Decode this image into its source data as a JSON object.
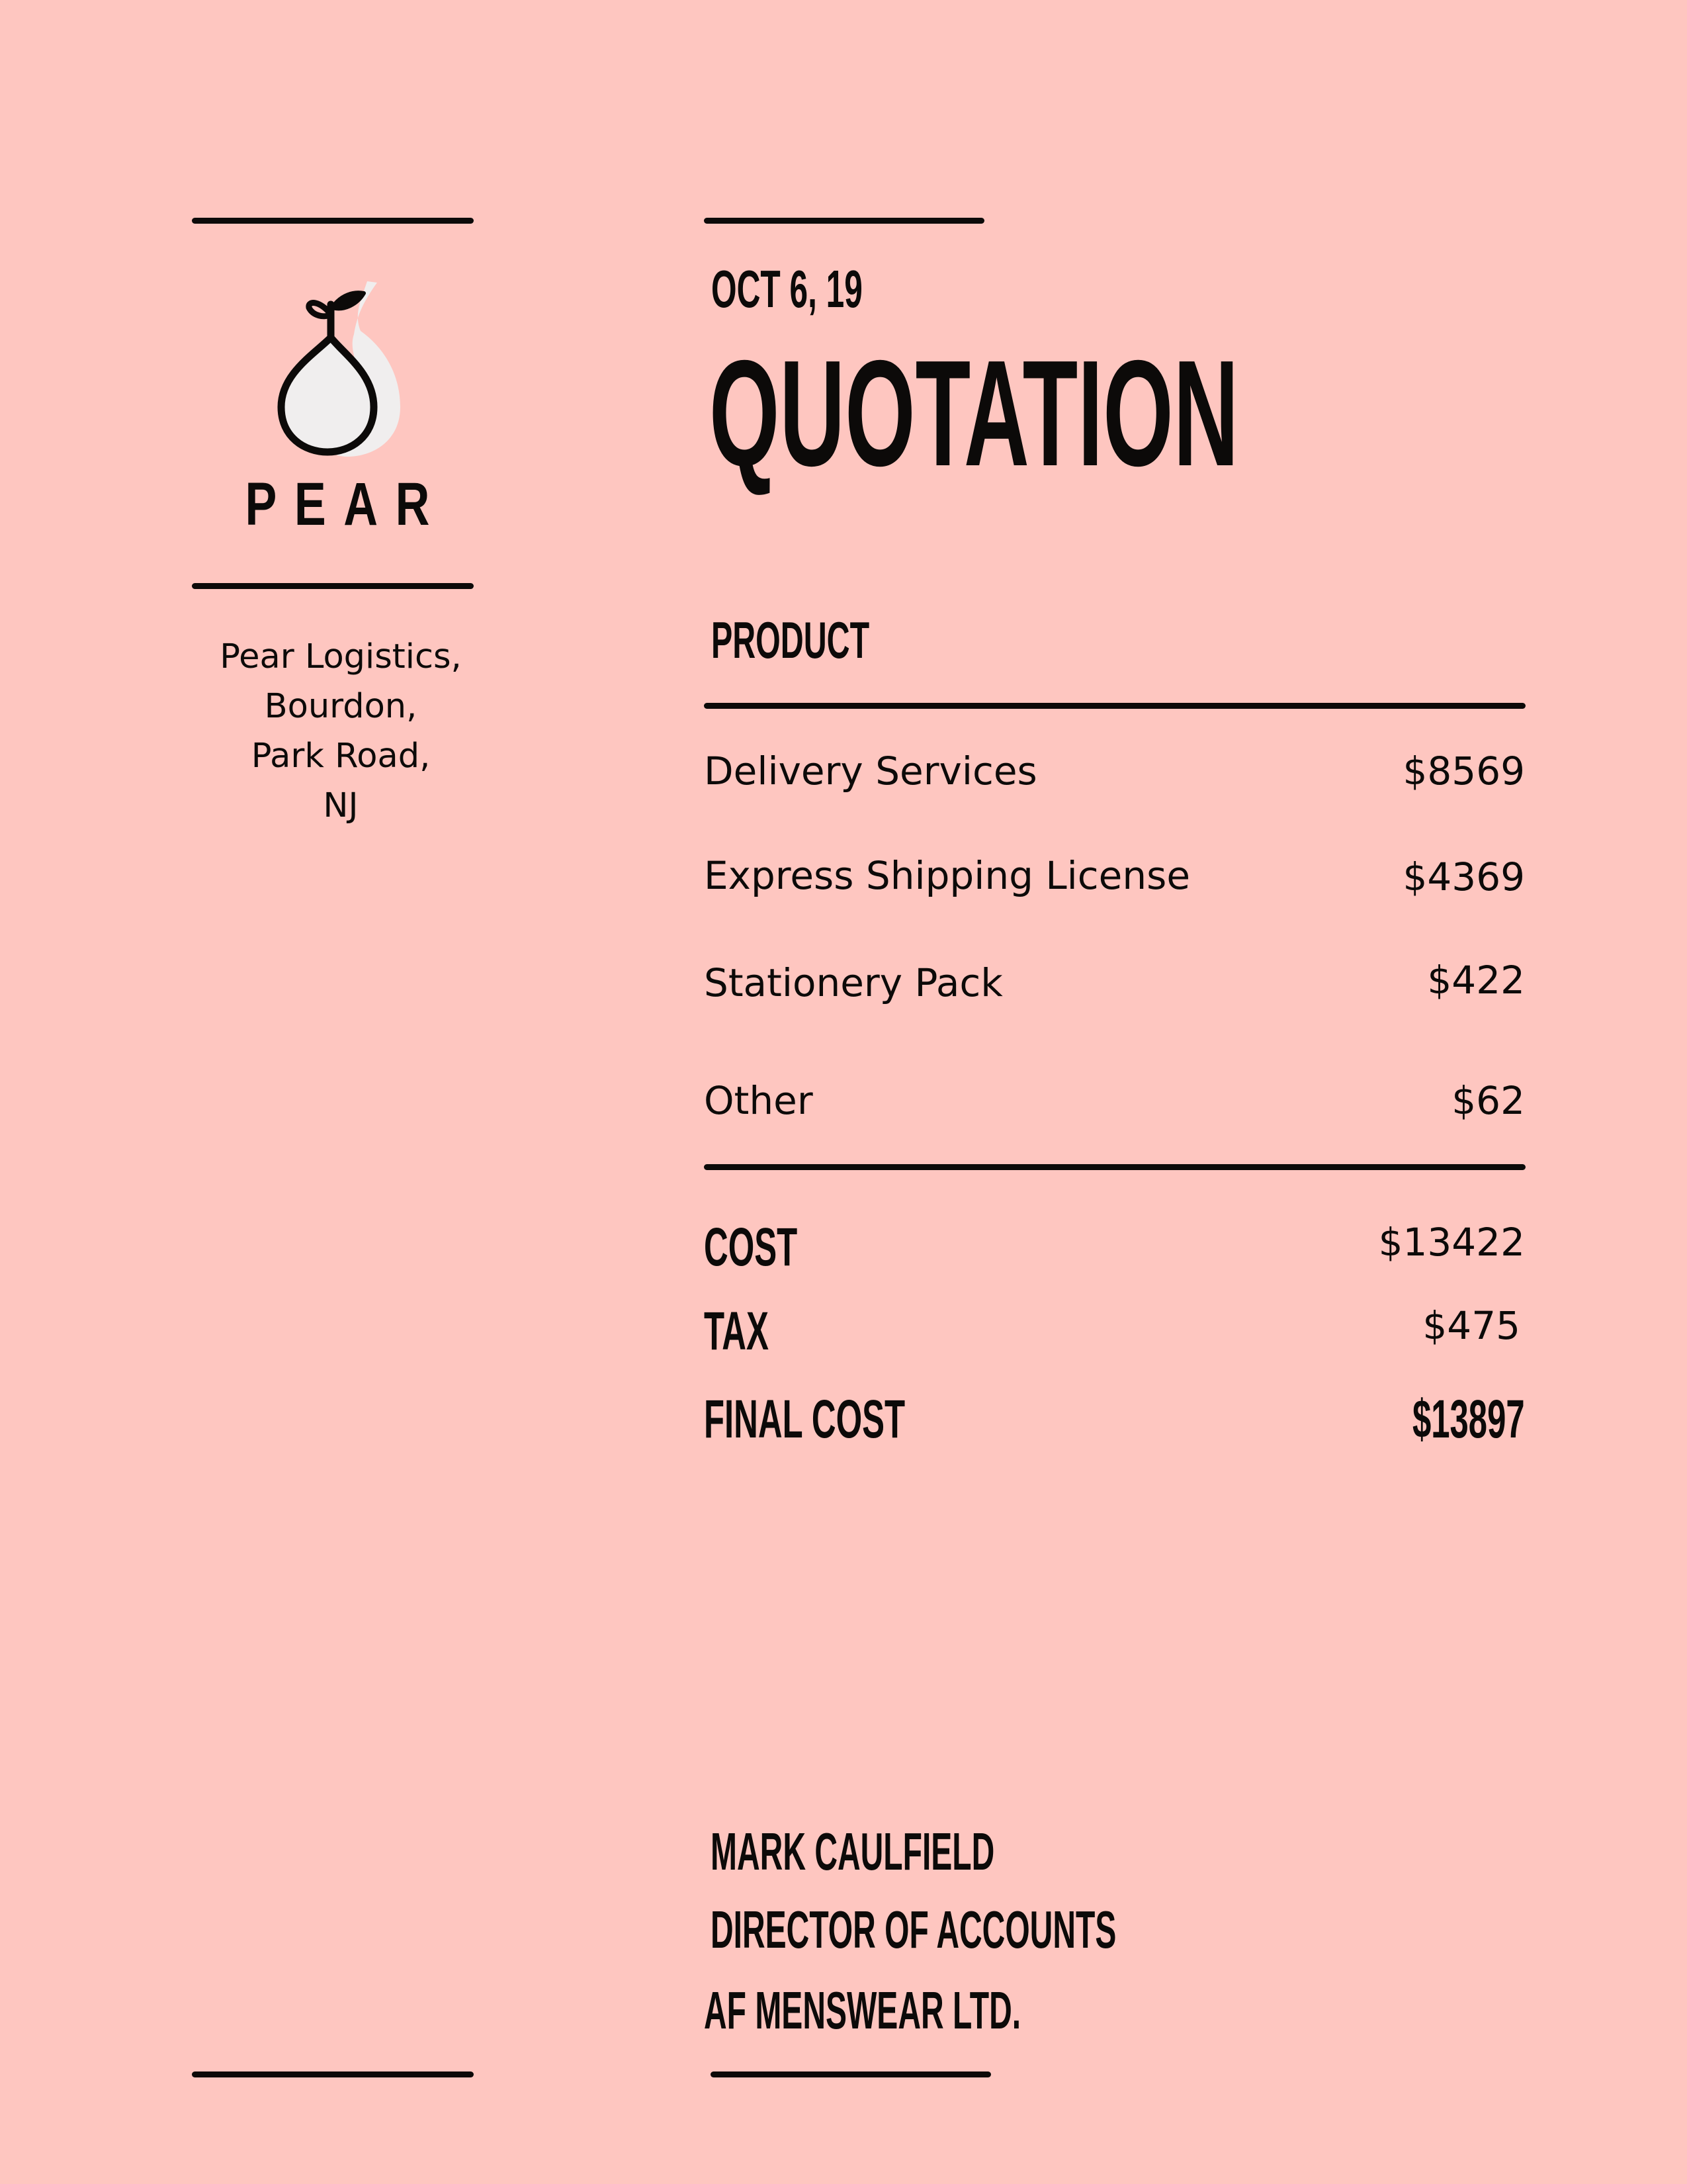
{
  "brand": {
    "name": "PEAR",
    "address_lines": [
      "Pear Logistics,",
      "Bourdon,",
      "Park Road,",
      "NJ"
    ]
  },
  "document": {
    "date": "OCT 6, 19",
    "title": "QUOTATION"
  },
  "product_section": {
    "header": "PRODUCT",
    "items": [
      {
        "name": "Delivery Services",
        "price": "$8569"
      },
      {
        "name": "Express Shipping License",
        "price": "$4369"
      },
      {
        "name": "Stationery Pack",
        "price": "$422"
      },
      {
        "name": "Other",
        "price": "$62"
      }
    ]
  },
  "summary": {
    "cost_label": "COST",
    "cost_value": "$13422",
    "tax_label": "TAX",
    "tax_value": "$475",
    "final_label": "FINAL COST",
    "final_value": "$13897"
  },
  "signatory": {
    "name": "MARK CAULFIELD",
    "role": "DIRECTOR OF ACCOUNTS",
    "company": "AF MENSWEAR LTD."
  },
  "colors": {
    "background": "#fec6c0",
    "ink": "#0c0a09",
    "pear_fill": "#f0eeee"
  },
  "icons": {
    "logo": "pear-icon"
  }
}
